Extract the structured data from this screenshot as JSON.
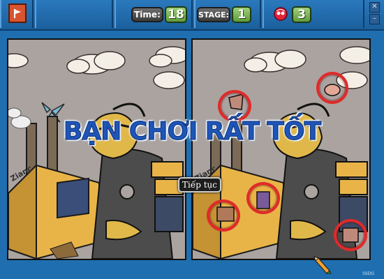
{
  "hud": {
    "time_label": "Time:",
    "time_value": "18",
    "stage_label": "STAGE:",
    "stage_value": "1",
    "lives_value": "3"
  },
  "overlay": {
    "message": "BẠN CHƠI RẤT TỐT",
    "continue_label": "Tiếp tục"
  },
  "scene": {
    "sign_text": "Zianc"
  },
  "footer": {
    "credit": "SSDG"
  },
  "colors": {
    "background": "#1f6fb0",
    "found_circle": "#e02a2a",
    "banner_text": "#1e55b8"
  },
  "icons": [
    "flag-exit-icon",
    "hearts-icon",
    "close-icon",
    "minimize-icon",
    "pencil-cursor-icon"
  ],
  "differences_found": 5
}
